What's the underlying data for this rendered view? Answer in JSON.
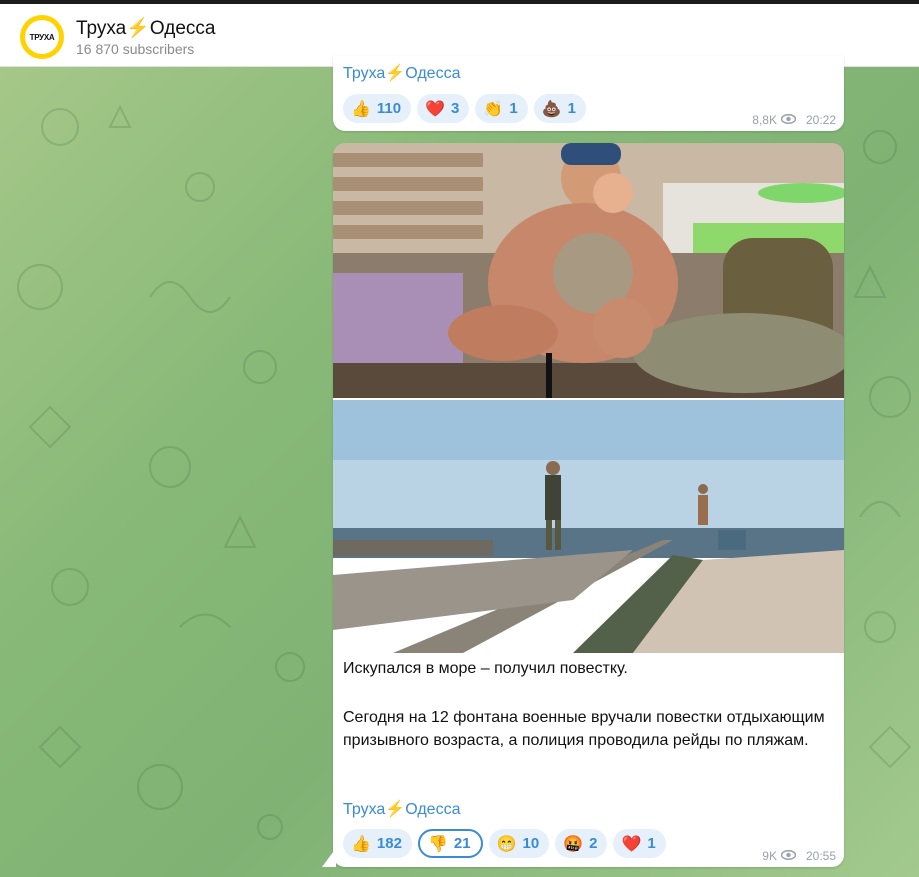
{
  "channel": {
    "name": "Труха",
    "bolt": "⚡",
    "city": "Одесса",
    "subscribers": "16 870 subscribers",
    "avatar_text": "ТРУХА"
  },
  "post1": {
    "signature_name": "Труха",
    "signature_bolt": "⚡",
    "signature_city": "Одесса",
    "reactions": [
      {
        "emoji": "👍",
        "count": "110"
      },
      {
        "emoji": "❤️",
        "count": "3"
      },
      {
        "emoji": "👏",
        "count": "1"
      },
      {
        "emoji": "💩",
        "count": "1"
      }
    ],
    "views": "8,8K",
    "time": "20:22"
  },
  "post2": {
    "title": "Искупался в море – получил повестку.",
    "body": "Сегодня на 12 фонтана военные вручали повестки отдыхающим призывного возраста, а полиция проводила рейды по пляжам.",
    "signature_name": "Труха",
    "signature_bolt": "⚡",
    "signature_city": "Одесса",
    "reactions": [
      {
        "emoji": "👍",
        "count": "182"
      },
      {
        "emoji": "👎",
        "count": "21",
        "selected": true
      },
      {
        "emoji": "😁",
        "count": "10"
      },
      {
        "emoji": "🤬",
        "count": "2"
      },
      {
        "emoji": "❤️",
        "count": "1"
      }
    ],
    "views": "9K",
    "time": "20:55"
  },
  "colors": {
    "accent": "#3a8bd6",
    "avatar": "#ffd200",
    "background": "#8fbd7c"
  },
  "icons": {
    "eye": "eye-icon",
    "bolt": "lightning-icon"
  }
}
